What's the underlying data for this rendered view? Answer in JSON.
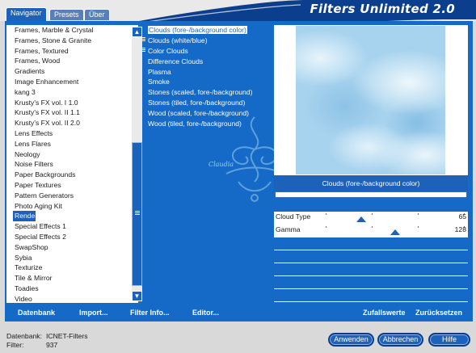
{
  "app": {
    "title": "Filters Unlimited 2.0"
  },
  "tabs": [
    {
      "label": "Navigator",
      "active": true
    },
    {
      "label": "Presets",
      "active": false
    },
    {
      "label": "Über",
      "active": false
    }
  ],
  "categories": {
    "items": [
      "Frames, Marble & Crystal",
      "Frames, Stone & Granite",
      "Frames, Textured",
      "Frames, Wood",
      "Gradients",
      "Image Enhancement",
      "kang 3",
      "Krusty's FX vol. I 1.0",
      "Krusty's FX vol. II 1.1",
      "Krusty's FX vol. II 2.0",
      "Lens Effects",
      "Lens Flares",
      "Neology",
      "Noise Filters",
      "Paper Backgrounds",
      "Paper Textures",
      "Pattern Generators",
      "Photo Aging Kit",
      "Render",
      "Special Effects 1",
      "Special Effects 2",
      "SwapShop",
      "Sybia",
      "Texturize",
      "Tile & Mirror",
      "Toadies",
      "Video"
    ],
    "selected": "Render"
  },
  "filters": {
    "items": [
      "Clouds (fore-/background color)",
      "Clouds (white/blue)",
      "Color Clouds",
      "Difference Clouds",
      "Plasma",
      "Smoke",
      "Stones (scaled, fore-/background)",
      "Stones (tiled, fore-/background)",
      "Wood (scaled, fore-/background)",
      "Wood (tiled, fore-/background)"
    ],
    "selected": "Clouds (fore-/background color)",
    "bulleted": [
      "Clouds (white/blue)",
      "Color Clouds"
    ]
  },
  "watermark": {
    "text": "Claudia"
  },
  "preview": {
    "filter_title": "Clouds (fore-/background color)"
  },
  "controls": [
    {
      "label": "Cloud Type",
      "value": "65",
      "level": 0.255
    },
    {
      "label": "Gamma",
      "value": "128",
      "level": 0.502
    }
  ],
  "bottom_bar": {
    "datenbank": "Datenbank",
    "import": "Import...",
    "filter_info": "Filter Info...",
    "editor": "Editor...",
    "zufallswerte": "Zufallswerte",
    "zuruecksetzen": "Zurücksetzen"
  },
  "footer": {
    "database_label": "Datenbank:",
    "database_value": "ICNET-Filters",
    "filter_label": "Filter:",
    "filter_value": "937",
    "apply": "Anwenden",
    "cancel": "Abbrechen",
    "help": "Hilfe"
  },
  "colors": {
    "panel_blue": "#1569c7",
    "accent_blue": "#1d62ba",
    "banner_navy": "#0b3e8c"
  }
}
